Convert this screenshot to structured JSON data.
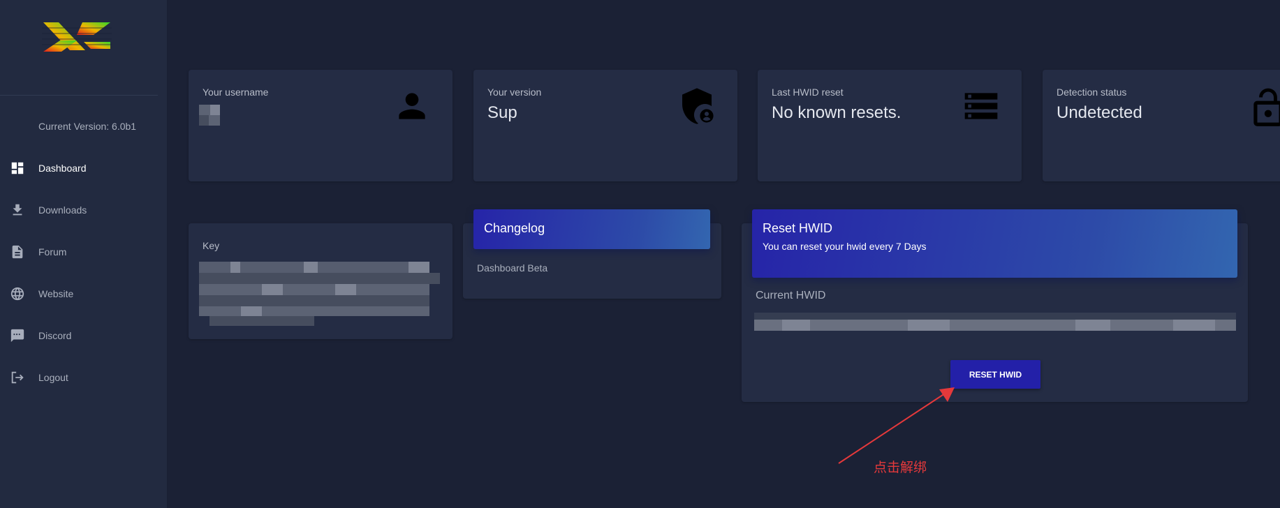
{
  "sidebar": {
    "version_text": "Current Version: 6.0b1",
    "items": [
      {
        "label": "Dashboard",
        "icon": "dashboard-icon",
        "active": true
      },
      {
        "label": "Downloads",
        "icon": "download-icon",
        "active": false
      },
      {
        "label": "Forum",
        "icon": "document-icon",
        "active": false
      },
      {
        "label": "Website",
        "icon": "globe-icon",
        "active": false
      },
      {
        "label": "Discord",
        "icon": "chat-icon",
        "active": false
      },
      {
        "label": "Logout",
        "icon": "logout-icon",
        "active": false
      }
    ]
  },
  "stats": {
    "username": {
      "label": "Your username",
      "icon": "person-icon"
    },
    "version": {
      "label": "Your version",
      "value": "Sup",
      "icon": "shield-user-icon"
    },
    "hwid_reset": {
      "label": "Last HWID reset",
      "value": "No known resets.",
      "icon": "server-icon"
    },
    "detection": {
      "label": "Detection status",
      "value": "Undetected",
      "icon": "unlock-icon"
    }
  },
  "key_card": {
    "label": "Key"
  },
  "changelog": {
    "title": "Changelog",
    "content": "Dashboard Beta"
  },
  "reset_hwid": {
    "title": "Reset HWID",
    "subtitle": "You can reset your hwid every 7 Days",
    "current_label": "Current HWID",
    "button_label": "RESET HWID"
  },
  "annotation": {
    "text": "点击解绑"
  },
  "colors": {
    "background": "#1b2135",
    "sidebar": "#222a40",
    "card": "#242c44",
    "accent": "#2624a8",
    "annotation": "#e5393b"
  }
}
